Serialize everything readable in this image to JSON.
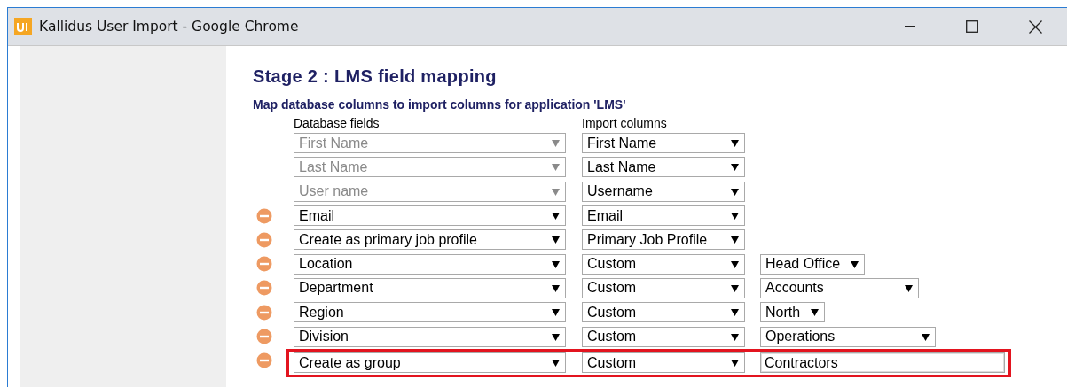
{
  "window": {
    "title": "Kallidus User Import - Google Chrome"
  },
  "page": {
    "heading": "Stage 2 : LMS field mapping",
    "subheading": "Map database columns to import columns for application 'LMS'"
  },
  "columns": [
    "Database fields",
    "Import columns"
  ],
  "rows": [
    {
      "removable": false,
      "highlighted": false,
      "database_field": {
        "value": "First Name",
        "disabled": true
      },
      "import_column": "First Name"
    },
    {
      "removable": false,
      "highlighted": false,
      "database_field": {
        "value": "Last Name",
        "disabled": true
      },
      "import_column": "Last Name"
    },
    {
      "removable": false,
      "highlighted": false,
      "database_field": {
        "value": "User name",
        "disabled": true
      },
      "import_column": "Username"
    },
    {
      "removable": true,
      "highlighted": false,
      "database_field": {
        "value": "Email",
        "disabled": false
      },
      "import_column": "Email"
    },
    {
      "removable": true,
      "highlighted": false,
      "database_field": {
        "value": "Create as primary job profile",
        "disabled": false
      },
      "import_column": "Primary Job Profile"
    },
    {
      "removable": true,
      "highlighted": false,
      "database_field": {
        "value": "Location",
        "disabled": false
      },
      "import_column": "Custom",
      "custom_value": {
        "kind": "select",
        "value": "Head Office"
      }
    },
    {
      "removable": true,
      "highlighted": false,
      "database_field": {
        "value": "Department",
        "disabled": false
      },
      "import_column": "Custom",
      "custom_value": {
        "kind": "select",
        "value": "Accounts"
      }
    },
    {
      "removable": true,
      "highlighted": false,
      "database_field": {
        "value": "Region",
        "disabled": false
      },
      "import_column": "Custom",
      "custom_value": {
        "kind": "select",
        "value": "North"
      }
    },
    {
      "removable": true,
      "highlighted": false,
      "database_field": {
        "value": "Division",
        "disabled": false
      },
      "import_column": "Custom",
      "custom_value": {
        "kind": "select",
        "value": "Operations"
      }
    },
    {
      "removable": true,
      "highlighted": true,
      "database_field": {
        "value": "Create as group",
        "disabled": false
      },
      "import_column": "Custom",
      "custom_value": {
        "kind": "text",
        "value": "Contractors"
      }
    }
  ]
}
